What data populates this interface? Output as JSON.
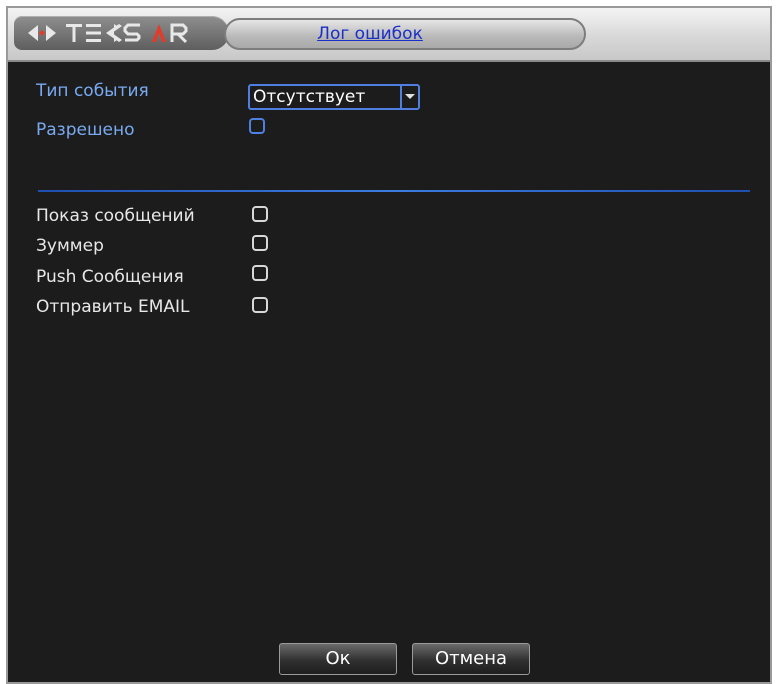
{
  "window": {
    "logo_text": "TEXSAR",
    "title": "Лог ошибок"
  },
  "form": {
    "event_type_label": "Тип события",
    "event_type_value": "Отсутствует",
    "enabled_label": "Разрешено",
    "enabled_checked": false
  },
  "actions": {
    "show_message_label": "Показ сообщений",
    "buzzer_label": "Зуммер",
    "push_label": "Push Сообщения",
    "email_label": "Отправить EMAIL"
  },
  "buttons": {
    "ok": "Ок",
    "cancel": "Отмена"
  },
  "colors": {
    "accent_blue": "#4f7fe0",
    "label_blue": "#79aaf0",
    "title_blue": "#1a2fc8",
    "logo_red": "#e23b2a"
  }
}
